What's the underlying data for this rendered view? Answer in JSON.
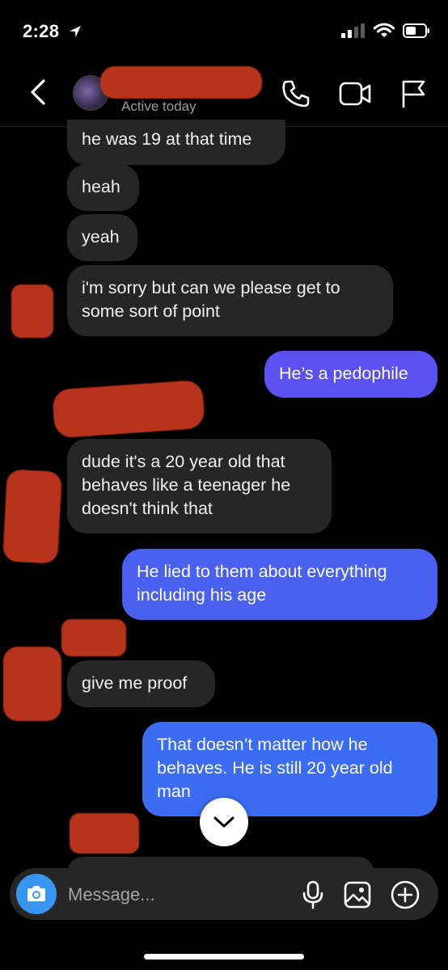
{
  "status_bar": {
    "time": "2:28"
  },
  "header": {
    "contact_name": "",
    "active_status": "Active today"
  },
  "messages": [
    {
      "direction": "incoming",
      "text": "he was 19 at that time"
    },
    {
      "direction": "incoming",
      "text": "heah"
    },
    {
      "direction": "incoming",
      "text": "yeah"
    },
    {
      "direction": "incoming",
      "text": "i'm sorry but can we please get to some sort of point"
    },
    {
      "direction": "outgoing",
      "text": "He’s a pedophile"
    },
    {
      "direction": "incoming",
      "text": "dude it's a 20 year old that behaves like a teenager he doesn't think that"
    },
    {
      "direction": "outgoing",
      "text": "He lied to them about everything including his age"
    },
    {
      "direction": "incoming",
      "text": "give me proof"
    },
    {
      "direction": "outgoing",
      "text": "That doesn’t matter how he behaves. He is still 20 year old man"
    }
  ],
  "composer": {
    "placeholder": "Message..."
  },
  "icons": {
    "back": "chevron-left-icon",
    "call": "phone-icon",
    "video": "video-camera-icon",
    "report": "flag-icon",
    "camera": "camera-icon",
    "mic": "microphone-icon",
    "gallery": "image-icon",
    "add": "plus-circle-icon",
    "scroll_down": "chevron-down-icon"
  },
  "colors": {
    "background": "#000000",
    "incoming_bubble": "#262626",
    "outgoing_purple": "#5b51f0",
    "outgoing_blue": "#3b6cf2",
    "accent": "#3797f0",
    "redaction": "#c2361d"
  }
}
